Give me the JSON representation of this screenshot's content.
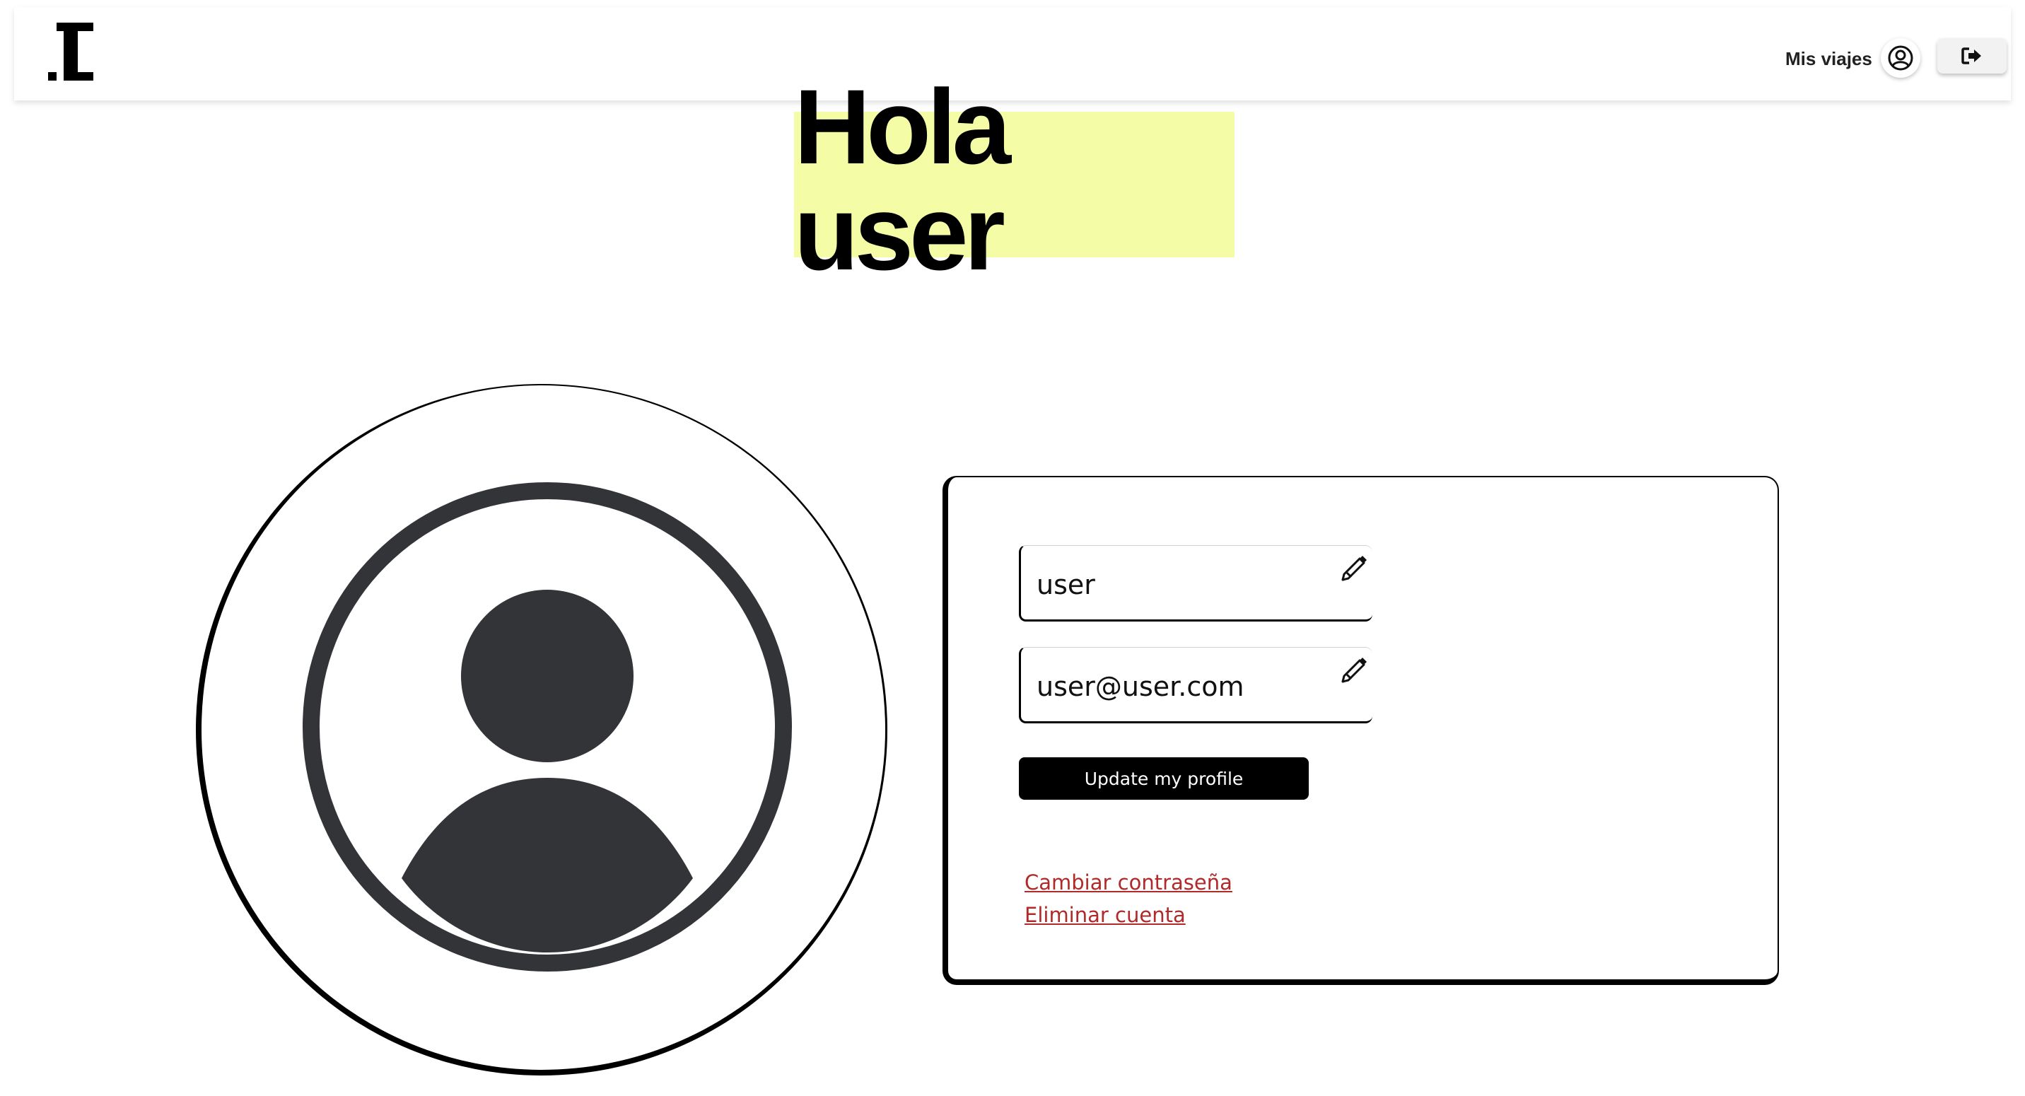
{
  "header": {
    "logo_icon": "brand-logo-icon",
    "nav_trips_label": "Mis viajes",
    "profile_icon": "user-circle-icon",
    "logout_icon": "logout-icon"
  },
  "greeting": {
    "text": "Hola user",
    "highlight_color": "#f4fca6"
  },
  "avatar": {
    "icon": "user-avatar-icon",
    "icon_color": "#333438"
  },
  "profile_form": {
    "username_value": "user",
    "email_value": "user@user.com",
    "edit_icon": "pencil-icon",
    "update_button_label": "Update my profile",
    "change_password_label": "Cambiar contraseña",
    "delete_account_label": "Eliminar cuenta",
    "link_color": "#b02a2a"
  }
}
